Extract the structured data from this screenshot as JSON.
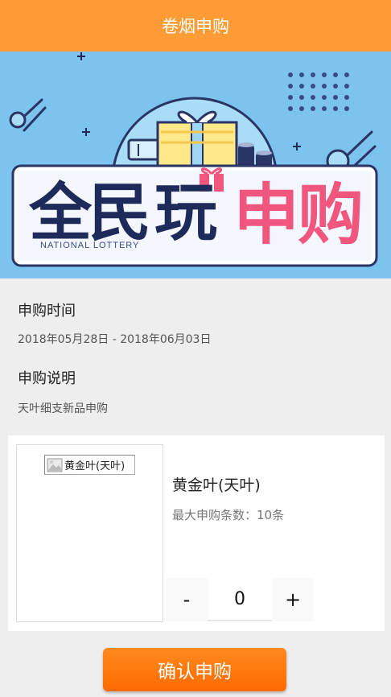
{
  "header": {
    "title": "卷烟申购"
  },
  "banner": {
    "title_left": "全民",
    "title_mid": "玩",
    "title_right": "申购",
    "subtitle": "NATIONAL LOTTERY"
  },
  "info": {
    "time_label": "申购时间",
    "time_value": "2018年05月28日 - 2018年06月03日",
    "desc_label": "申购说明",
    "desc_value": "天叶细支新品申购"
  },
  "product": {
    "image_alt": "黄金叶(天叶)",
    "name": "黄金叶(天叶)",
    "limit": "最大申购条数：10条",
    "minus_label": "-",
    "quantity": "0",
    "plus_label": "+"
  },
  "confirm_label": "确认申购",
  "colors": {
    "header_bg": "#ff9c36",
    "banner_bg": "#7cc3ee",
    "accent_pink": "#f0567e",
    "navy": "#1e2a5a",
    "button": "#ff7a10"
  },
  "icons": [
    "broken-image-icon",
    "gift-icon",
    "ticket-icon",
    "comet-icon"
  ]
}
